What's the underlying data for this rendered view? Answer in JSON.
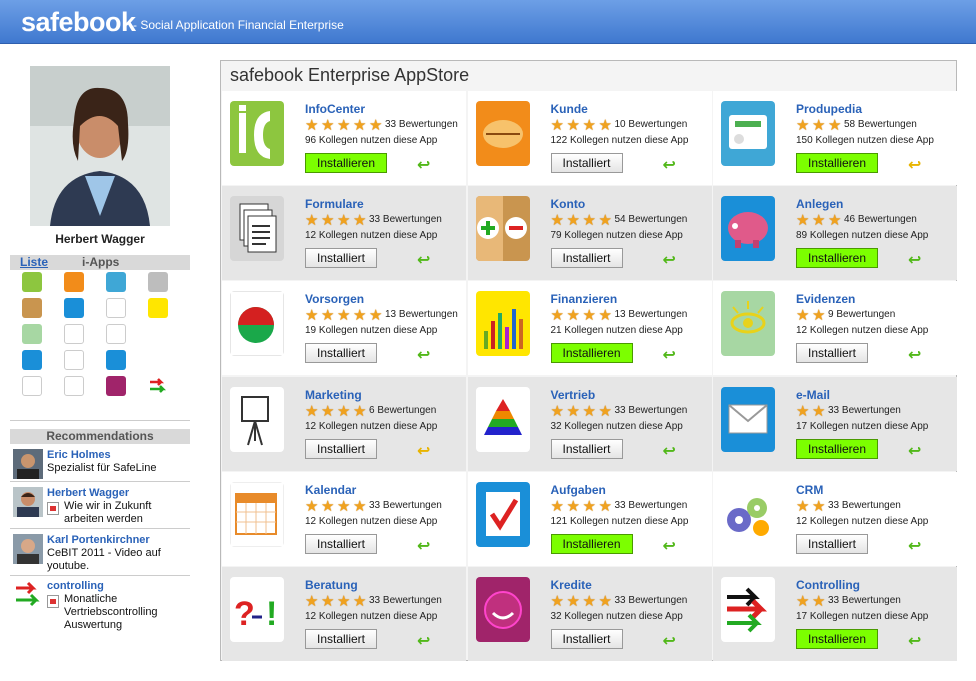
{
  "header": {
    "brand": "safebook",
    "tagline": "- Social Application Financial Enterprise"
  },
  "profile": {
    "name": "Herbert Wagger"
  },
  "tabs": {
    "liste": "Liste",
    "iapps": "i-Apps"
  },
  "recommendations": {
    "title": "Recommendations",
    "items": [
      {
        "name": "Eric Holmes",
        "text": "Spezialist für SafeLine"
      },
      {
        "name": "Herbert Wagger",
        "text": "Wie wir in Zukunft arbeiten werden"
      },
      {
        "name": "Karl Portenkirchner",
        "text": "CeBIT 2011 - Video auf youtube."
      },
      {
        "name": "controlling",
        "text": "Monatliche Vertriebscontrolling Auswertung"
      }
    ]
  },
  "store": {
    "title": "safebook Enterprise AppStore",
    "apps": [
      {
        "name": "InfoCenter",
        "rating": 5,
        "reviews": "33 Bewertungen",
        "users": "96 Kollegen nutzen diese App",
        "button": "Installieren",
        "installed": false,
        "arrow": "green",
        "icon": "infocenter-icon",
        "color": "#8dc63f"
      },
      {
        "name": "Kunde",
        "rating": 4,
        "reviews": "10 Bewertungen",
        "users": "122 Kollegen nutzen diese App",
        "button": "Installiert",
        "installed": true,
        "arrow": "green",
        "icon": "handshake-icon",
        "color": "#f28c1a"
      },
      {
        "name": "Produpedia",
        "rating": 3,
        "reviews": "58 Bewertungen",
        "users": "150 Kollegen nutzen diese App",
        "button": "Installieren",
        "installed": false,
        "arrow": "yellow",
        "icon": "produpedia-icon",
        "color": "#3fa7d6"
      },
      {
        "name": "Formulare",
        "rating": 4,
        "reviews": "33 Bewertungen",
        "users": "12 Kollegen nutzen diese App",
        "button": "Installiert",
        "installed": true,
        "arrow": "green",
        "icon": "documents-icon",
        "color": "#bdbdbd"
      },
      {
        "name": "Konto",
        "rating": 4,
        "reviews": "54 Bewertungen",
        "users": "79 Kollegen nutzen diese App",
        "button": "Installiert",
        "installed": true,
        "arrow": "green",
        "icon": "plus-minus-icon",
        "color": "#c9954f"
      },
      {
        "name": "Anlegen",
        "rating": 3,
        "reviews": "46 Bewertungen",
        "users": "89 Kollegen nutzen diese App",
        "button": "Installieren",
        "installed": false,
        "arrow": "green",
        "icon": "piggy-bank-icon",
        "color": "#1a8fd8"
      },
      {
        "name": "Vorsorgen",
        "rating": 5,
        "reviews": "13 Bewertungen",
        "users": "19 Kollegen nutzen diese App",
        "button": "Installiert",
        "installed": true,
        "arrow": "green",
        "icon": "pie-chart-icon",
        "color": "#ffffff"
      },
      {
        "name": "Finanzieren",
        "rating": 4,
        "reviews": "13 Bewertungen",
        "users": "21 Kollegen nutzen diese App",
        "button": "Installieren",
        "installed": false,
        "arrow": "green",
        "icon": "bar-chart-icon",
        "color": "#ffe600"
      },
      {
        "name": "Evidenzen",
        "rating": 2,
        "reviews": "9 Bewertungen",
        "users": "12 Kollegen nutzen diese App",
        "button": "Installiert",
        "installed": true,
        "arrow": "green",
        "icon": "eye-icon",
        "color": "#a7d7a3"
      },
      {
        "name": "Marketing",
        "rating": 4,
        "reviews": "6 Bewertungen",
        "users": "12 Kollegen nutzen diese App",
        "button": "Installiert",
        "installed": true,
        "arrow": "yellow",
        "icon": "easel-icon",
        "color": "#ffffff"
      },
      {
        "name": "Vertrieb",
        "rating": 4,
        "reviews": "33 Bewertungen",
        "users": "32 Kollegen nutzen diese App",
        "button": "Installiert",
        "installed": true,
        "arrow": "green",
        "icon": "pyramid-icon",
        "color": "#ffffff"
      },
      {
        "name": "e-Mail",
        "rating": 2,
        "reviews": "33 Bewertungen",
        "users": "17 Kollegen nutzen diese App",
        "button": "Installieren",
        "installed": false,
        "arrow": "green",
        "icon": "envelope-icon",
        "color": "#1a8fd8"
      },
      {
        "name": "Kalendar",
        "rating": 4,
        "reviews": "33 Bewertungen",
        "users": "12 Kollegen nutzen diese App",
        "button": "Installiert",
        "installed": true,
        "arrow": "green",
        "icon": "calendar-icon",
        "color": "#ffffff"
      },
      {
        "name": "Aufgaben",
        "rating": 4,
        "reviews": "33 Bewertungen",
        "users": "121 Kollegen nutzen diese App",
        "button": "Installieren",
        "installed": false,
        "arrow": "green",
        "icon": "checkmark-icon",
        "color": "#1a8fd8"
      },
      {
        "name": "CRM",
        "rating": 2,
        "reviews": "33 Bewertungen",
        "users": "12 Kollegen nutzen diese App",
        "button": "Installiert",
        "installed": true,
        "arrow": "green",
        "icon": "gears-icon",
        "color": "#ffffff"
      },
      {
        "name": "Beratung",
        "rating": 4,
        "reviews": "33 Bewertungen",
        "users": "12 Kollegen nutzen diese App",
        "button": "Installiert",
        "installed": true,
        "arrow": "green",
        "icon": "question-exclaim-icon",
        "color": "#ffffff"
      },
      {
        "name": "Kredite",
        "rating": 4,
        "reviews": "33 Bewertungen",
        "users": "32 Kollegen nutzen diese App",
        "button": "Installiert",
        "installed": true,
        "arrow": "green",
        "icon": "phone-circle-icon",
        "color": "#a0246a"
      },
      {
        "name": "Controlling",
        "rating": 2,
        "reviews": "33 Bewertungen",
        "users": "17 Kollegen nutzen diese App",
        "button": "Installieren",
        "installed": false,
        "arrow": "green",
        "icon": "arrows-icon",
        "color": "#ffffff"
      }
    ]
  }
}
